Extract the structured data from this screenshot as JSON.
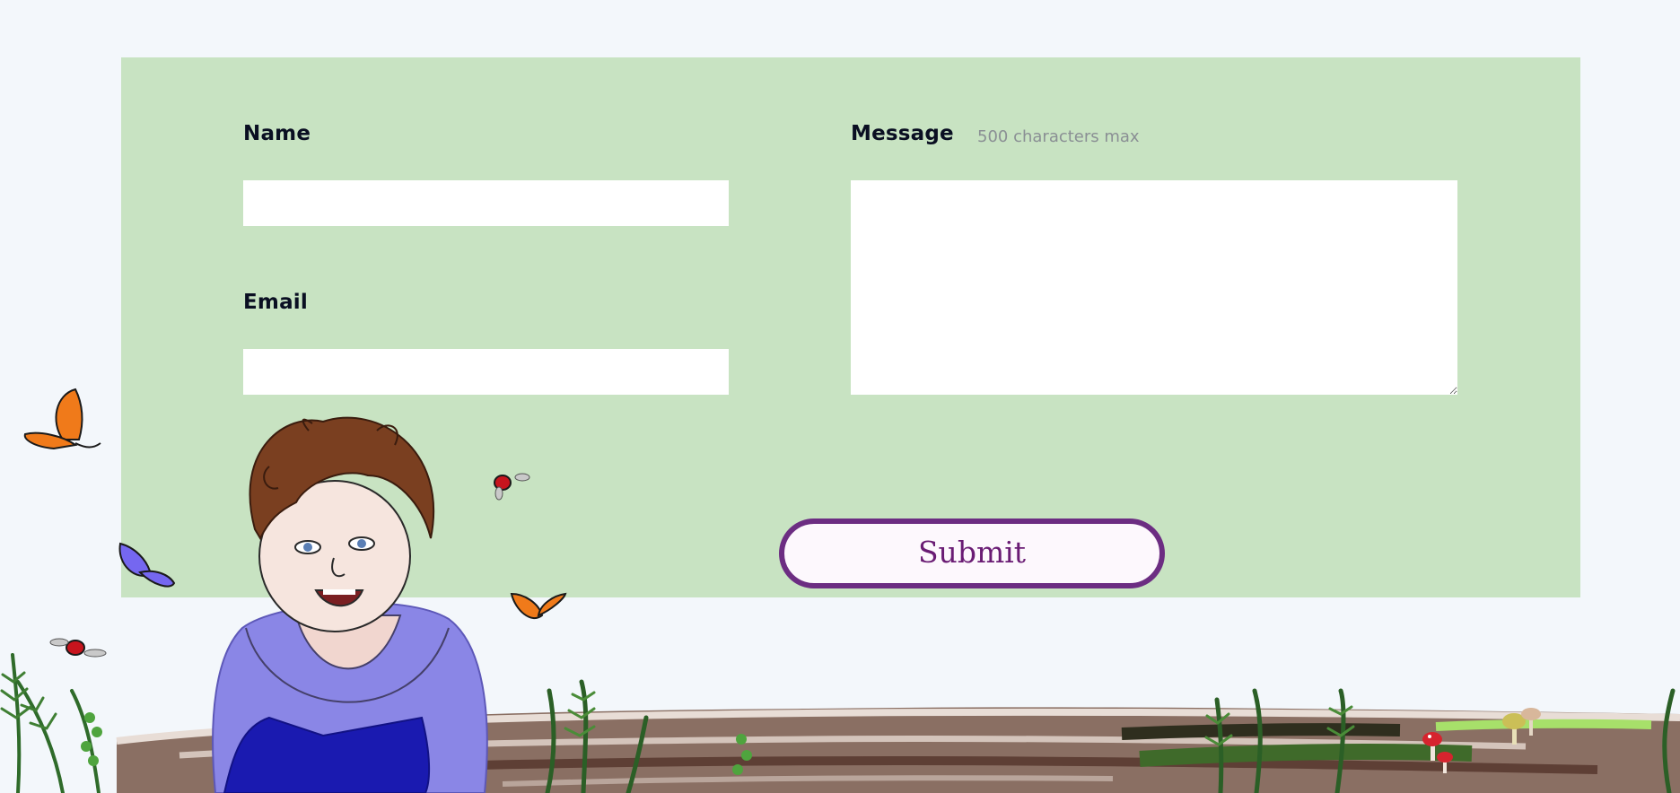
{
  "form": {
    "name_label": "Name",
    "name_value": "",
    "email_label": "Email",
    "email_value": "",
    "message_label": "Message",
    "message_hint": "500 characters max",
    "message_value": "",
    "submit_label": "Submit"
  },
  "colors": {
    "page_background": "#f3f7fb",
    "panel_background": "#c8e3c2",
    "label_text": "#0a0f22",
    "hint_text": "#8a8f94",
    "button_border": "#6c2d82",
    "button_text": "#6a1c74",
    "button_fill": "#fdf8fd"
  },
  "decorations": {
    "illustration": "child-illustration",
    "icons": [
      "butterfly-icon",
      "ladybug-icon",
      "fern-icon",
      "mushroom-icon",
      "log-icon"
    ]
  }
}
